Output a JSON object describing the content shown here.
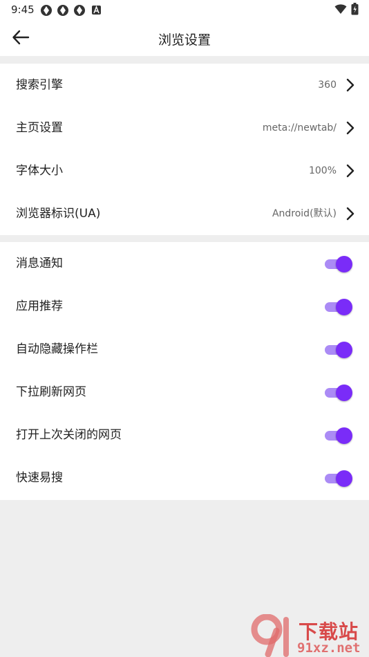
{
  "status_bar": {
    "time": "9:45",
    "left_icons": [
      "aperture-icon",
      "aperture-icon",
      "aperture-icon",
      "font-a-icon"
    ],
    "right_icons": [
      "wifi-icon",
      "battery-icon"
    ]
  },
  "header": {
    "title": "浏览设置",
    "back_icon": "arrow-left-icon"
  },
  "nav_settings": [
    {
      "label": "搜索引擎",
      "value": "360"
    },
    {
      "label": "主页设置",
      "value": "meta://newtab/"
    },
    {
      "label": "字体大小",
      "value": "100%"
    },
    {
      "label": "浏览器标识(UA)",
      "value": "Android(默认)"
    }
  ],
  "toggle_settings": [
    {
      "label": "消息通知",
      "enabled": true
    },
    {
      "label": "应用推荐",
      "enabled": true
    },
    {
      "label": "自动隐藏操作栏",
      "enabled": true
    },
    {
      "label": "下拉刷新网页",
      "enabled": true
    },
    {
      "label": "打开上次关闭的网页",
      "enabled": true
    },
    {
      "label": "快速易搜",
      "enabled": true
    }
  ],
  "watermark": {
    "title": "下载站",
    "site": "91xz.net"
  },
  "colors": {
    "accent": "#7a2cf8",
    "toggle_track": "#ab8bf5",
    "page_bg": "#eeeeee",
    "watermark": "#d84a4a"
  }
}
